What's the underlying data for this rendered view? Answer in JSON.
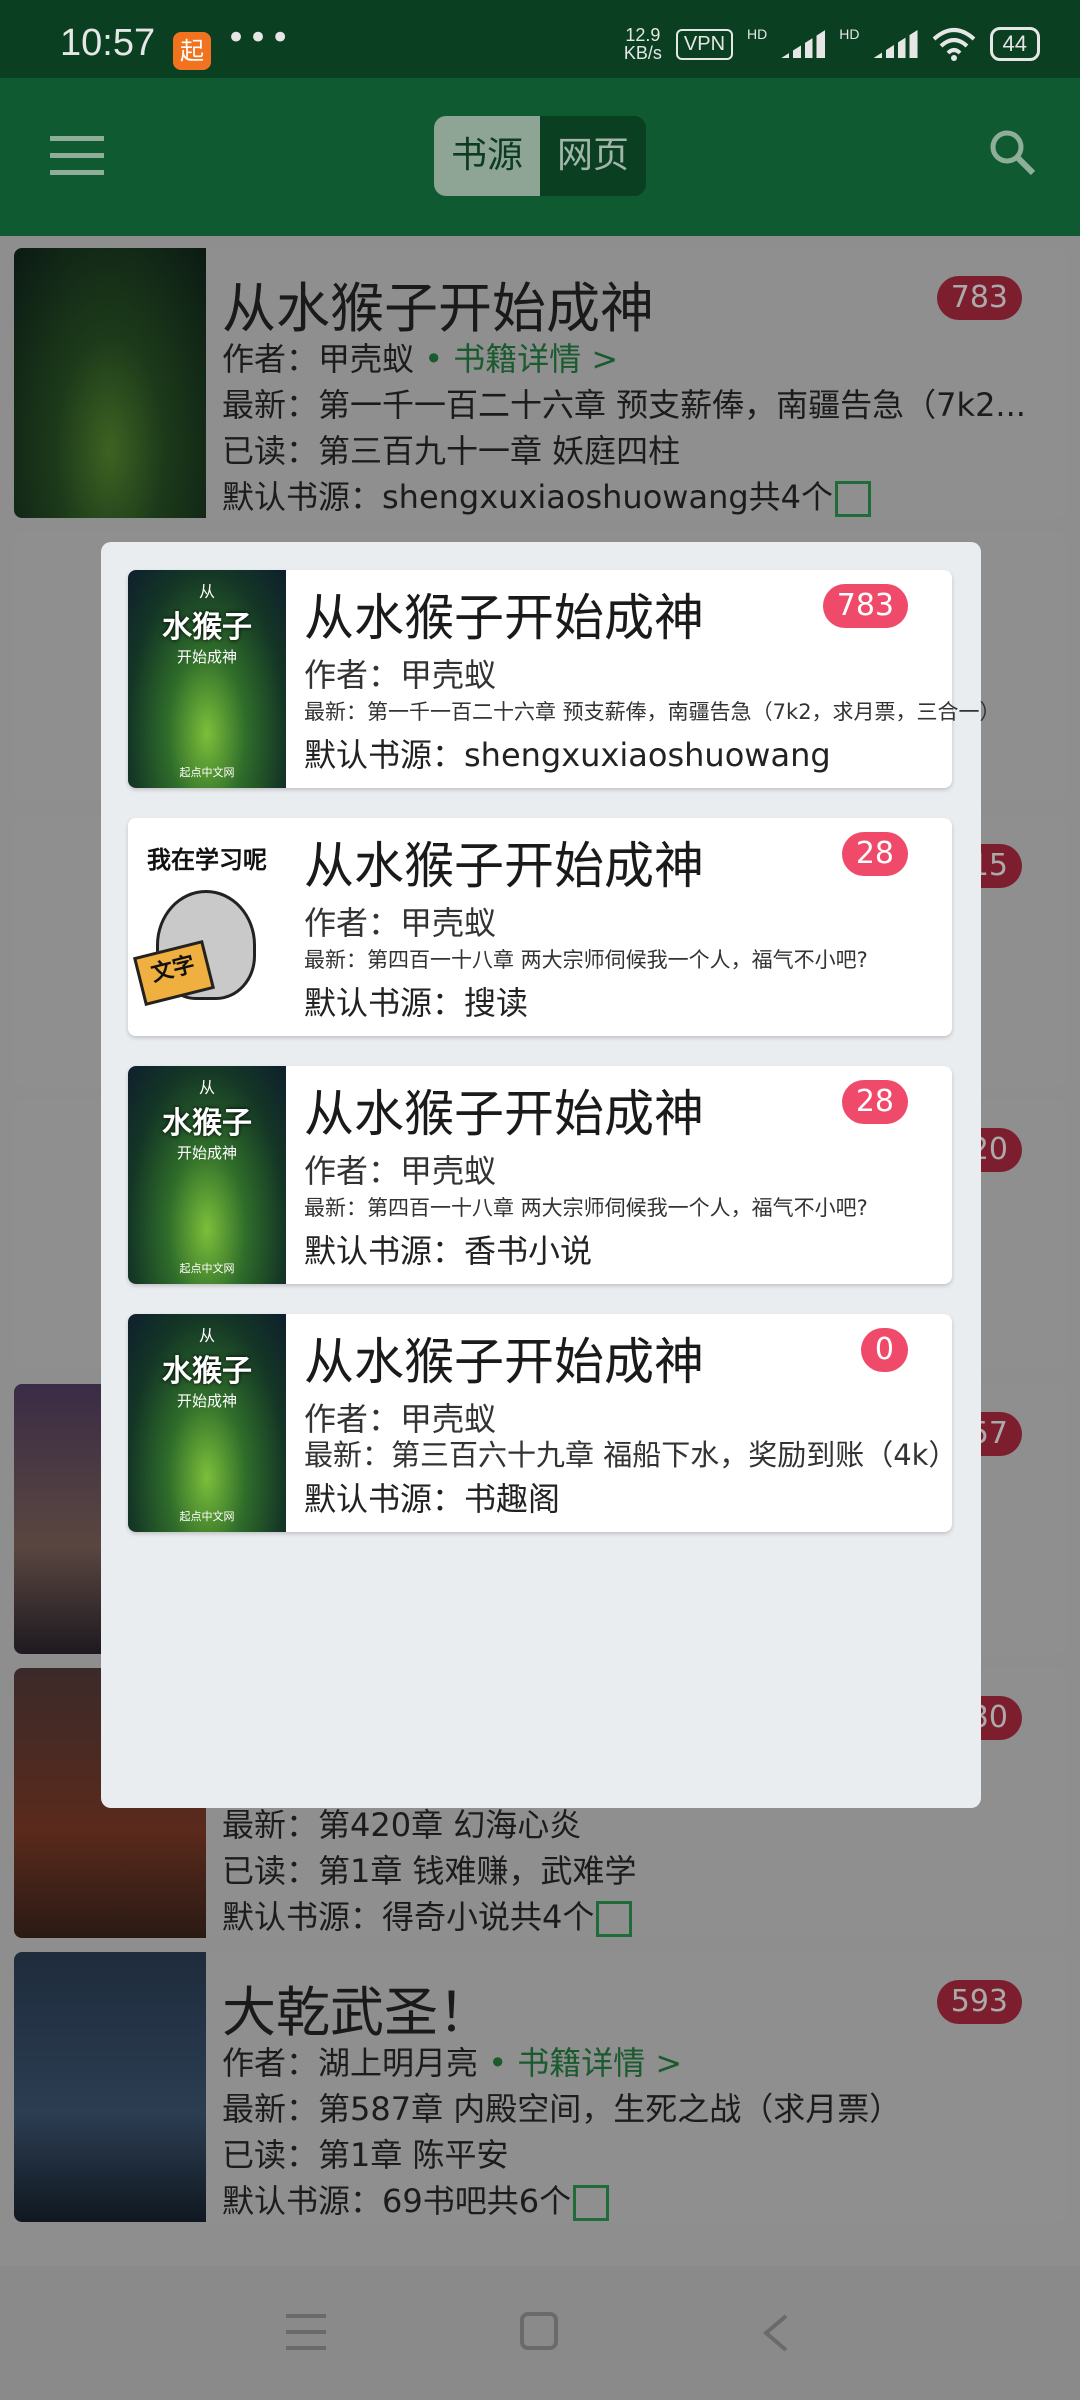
{
  "status_bar": {
    "time": "10:57",
    "net_speed_value": "12.9",
    "net_speed_unit": "KB/s",
    "vpn": "VPN",
    "hd1": "HD",
    "hd2": "HD",
    "battery": "44",
    "app_icon": "app-notification-icon"
  },
  "toolbar": {
    "tab_source": "书源",
    "tab_web": "网页",
    "active_tab": "书源"
  },
  "background_list": [
    {
      "title": "从水猴子开始成神",
      "count": "783",
      "author_line": "作者：甲壳蚁",
      "detail_link": "• 书籍详情 >",
      "latest": "最新：第一千一百二十六章 预支薪俸，南疆告急（7k2...",
      "read": "已读：第三百九十一章 妖庭四柱",
      "source": "默认书源：shengxuxiaoshuowang共4个"
    },
    {
      "count": "15"
    },
    {
      "count": "20"
    },
    {
      "count": "57"
    },
    {
      "count": "30",
      "latest": "最新：第420章 幻海心炎",
      "read": "已读：第1章 钱难赚，武难学",
      "source": "默认书源：得奇小说共4个"
    },
    {
      "title": "大乾武圣！",
      "count": "593",
      "author_line": "作者：湖上明月亮",
      "detail_link": "• 书籍详情 >",
      "latest": "最新：第587章 内殿空间，生死之战（求月票）",
      "read": "已读：第1章 陈平安",
      "source": "默认书源：69书吧共6个"
    }
  ],
  "dialog": {
    "items": [
      {
        "title": "从水猴子开始成神",
        "count": "783",
        "author": "作者：甲壳蚁",
        "latest": "最新：第一千一百二十六章 预支薪俸，南疆告急（7k2，求月票，三合一）",
        "source": "默认书源：shengxuxiaoshuowang",
        "cover_small": "从",
        "cover_title": "水猴子",
        "cover_sub": "开始成神",
        "cover_pub": "起点中文网"
      },
      {
        "title": "从水猴子开始成神",
        "count": "28",
        "author": "作者：甲壳蚁",
        "latest": "最新：第四百一十八章 两大宗师伺候我一个人，福气不小吧?",
        "source": "默认书源：搜读",
        "cover_text": "我在学习呢",
        "cover_book": "文字"
      },
      {
        "title": "从水猴子开始成神",
        "count": "28",
        "author": "作者：甲壳蚁",
        "latest": "最新：第四百一十八章 两大宗师伺候我一个人，福气不小吧?",
        "source": "默认书源：香书小说",
        "cover_small": "从",
        "cover_title": "水猴子",
        "cover_sub": "开始成神",
        "cover_pub": "起点中文网"
      },
      {
        "title": "从水猴子开始成神",
        "count": "0",
        "author": "作者：甲壳蚁",
        "latest": "最新：第三百六十九章 福船下水，奖励到账（4k）",
        "source": "默认书源：书趣阁",
        "cover_small": "从",
        "cover_title": "水猴子",
        "cover_sub": "开始成神",
        "cover_pub": "起点中文网"
      }
    ]
  },
  "colors": {
    "toolbar_bg": "#0f5a30",
    "badge": "#f04a6a",
    "link_green": "#1a5a2f"
  }
}
